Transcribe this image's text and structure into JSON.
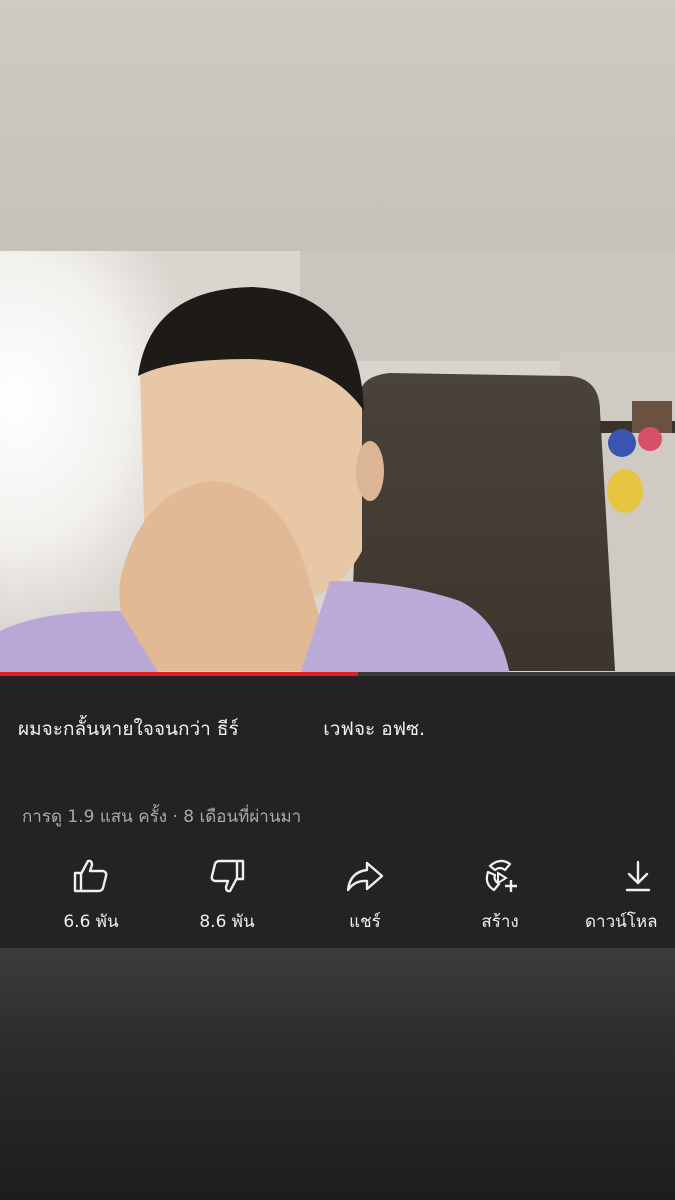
{
  "video": {
    "progress_fraction": 0.53
  },
  "info": {
    "title": "ผมจะกลั้นหายใจจนกว่า ธีร์              เวฟจะ อฟซ.",
    "meta": "การดู 1.9 แสน ครั้ง · 8 เดือนที่ผ่านมา"
  },
  "actions": [
    {
      "icon": "thumbs-up-icon",
      "label": "6.6 พัน"
    },
    {
      "icon": "thumbs-down-icon",
      "label": "8.6 พัน"
    },
    {
      "icon": "share-icon",
      "label": "แชร์"
    },
    {
      "icon": "create-icon",
      "label": "สร้าง"
    },
    {
      "icon": "download-icon",
      "label": "ดาวน์โหล"
    }
  ],
  "colors": {
    "progress": "#e0201c",
    "panel": "#232323",
    "text": "#f1f1f1",
    "meta": "#a9a9a9"
  }
}
